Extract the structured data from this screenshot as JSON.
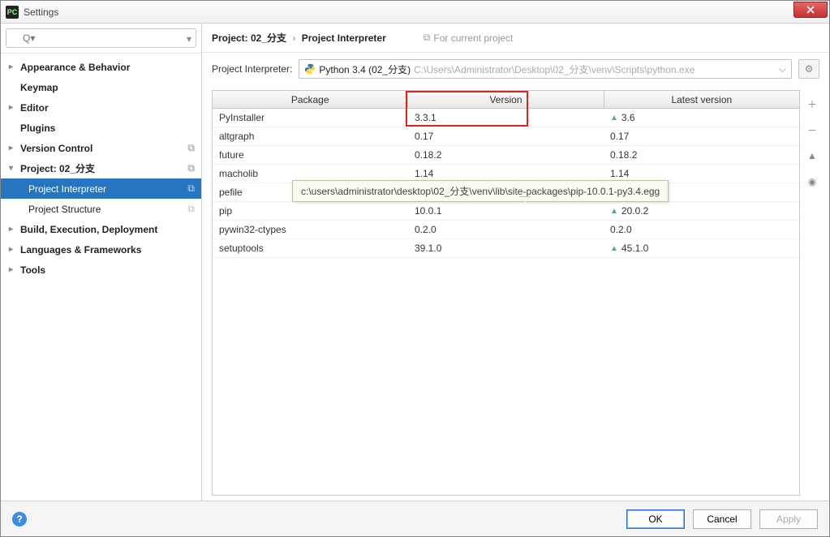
{
  "window": {
    "title": "Settings"
  },
  "search": {
    "placeholder": "Q▾"
  },
  "sidebar": {
    "items": [
      {
        "label": "Appearance & Behavior",
        "bold": true,
        "arrow": "closed"
      },
      {
        "label": "Keymap",
        "bold": true,
        "arrow": "none"
      },
      {
        "label": "Editor",
        "bold": true,
        "arrow": "closed"
      },
      {
        "label": "Plugins",
        "bold": true,
        "arrow": "none"
      },
      {
        "label": "Version Control",
        "bold": true,
        "arrow": "closed",
        "copy": true
      },
      {
        "label": "Project: 02_分支",
        "bold": true,
        "arrow": "open",
        "copy": true
      },
      {
        "label": "Project Interpreter",
        "child": true,
        "selected": true,
        "copy": true
      },
      {
        "label": "Project Structure",
        "child": true,
        "copy": true
      },
      {
        "label": "Build, Execution, Deployment",
        "bold": true,
        "arrow": "closed"
      },
      {
        "label": "Languages & Frameworks",
        "bold": true,
        "arrow": "closed"
      },
      {
        "label": "Tools",
        "bold": true,
        "arrow": "closed"
      }
    ]
  },
  "breadcrumb": {
    "project": "Project: 02_分支",
    "page": "Project Interpreter",
    "hint": "For current project"
  },
  "interpreter": {
    "label": "Project Interpreter:",
    "name": "Python 3.4 (02_分支)",
    "path": "C:\\Users\\Administrator\\Desktop\\02_分支\\venv\\Scripts\\python.exe"
  },
  "table": {
    "headers": {
      "package": "Package",
      "version": "Version",
      "latest": "Latest version"
    },
    "rows": [
      {
        "package": "PyInstaller",
        "version": "3.3.1",
        "latest": "3.6",
        "upgrade": true
      },
      {
        "package": "altgraph",
        "version": "0.17",
        "latest": "0.17"
      },
      {
        "package": "future",
        "version": "0.18.2",
        "latest": "0.18.2"
      },
      {
        "package": "macholib",
        "version": "1.14",
        "latest": "1.14"
      },
      {
        "package": "pefile",
        "version": "",
        "latest": ""
      },
      {
        "package": "pip",
        "version": "10.0.1",
        "latest": "20.0.2",
        "upgrade": true
      },
      {
        "package": "pywin32-ctypes",
        "version": "0.2.0",
        "latest": "0.2.0"
      },
      {
        "package": "setuptools",
        "version": "39.1.0",
        "latest": "45.1.0",
        "upgrade": true
      }
    ]
  },
  "tooltip": {
    "text": "c:\\users\\administrator\\desktop\\02_分支\\venv\\lib\\site-packages\\pip-10.0.1-py3.4.egg"
  },
  "footer": {
    "ok": "OK",
    "cancel": "Cancel",
    "apply": "Apply"
  }
}
